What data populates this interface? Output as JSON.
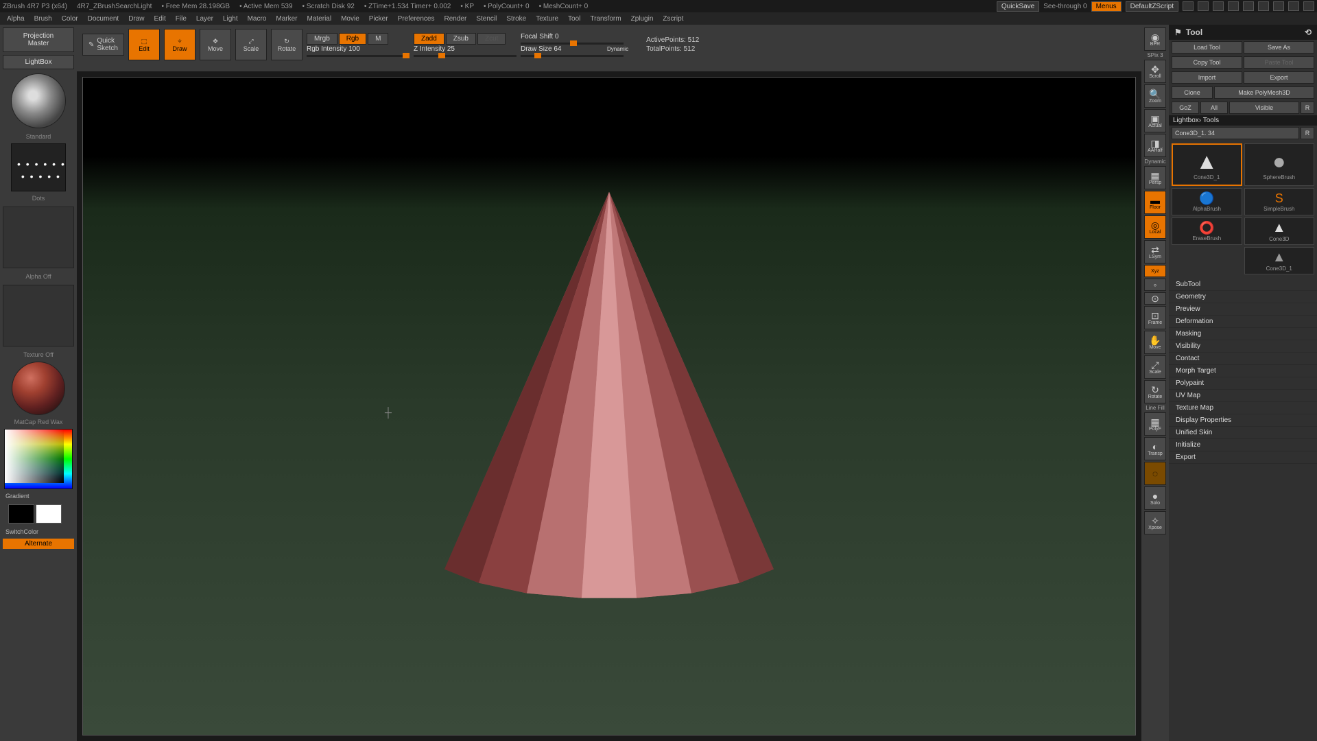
{
  "title": {
    "app": "ZBrush 4R7 P3 (x64)",
    "doc": "4R7_ZBrushSearchLight",
    "freemem": "• Free Mem 28.198GB",
    "activemem": "• Active Mem 539",
    "scratch": "• Scratch Disk 92",
    "ztime": "• ZTime+1.534 Timer+ 0.002",
    "kp": "• KP",
    "polycount": "• PolyCount+ 0",
    "meshcount": "• MeshCount+ 0"
  },
  "titleRight": {
    "quicksave": "QuickSave",
    "seethrough": "See-through   0",
    "menus": "Menus",
    "script": "DefaultZScript"
  },
  "menus": [
    "Alpha",
    "Brush",
    "Color",
    "Document",
    "Draw",
    "Edit",
    "File",
    "Layer",
    "Light",
    "Macro",
    "Marker",
    "Material",
    "Movie",
    "Picker",
    "Preferences",
    "Render",
    "Stencil",
    "Stroke",
    "Texture",
    "Tool",
    "Transform",
    "Zplugin",
    "Zscript"
  ],
  "leftPanel": {
    "projection": "Projection\nMaster",
    "lightbox": "LightBox",
    "standard": "Standard",
    "dots": "Dots",
    "alphaOff": "Alpha Off",
    "textureOff": "Texture Off",
    "matcap": "MatCap Red Wax",
    "gradient": "Gradient",
    "switchcolor": "SwitchColor",
    "alternate": "Alternate"
  },
  "toolbar": {
    "quicksketch": "Quick\nSketch",
    "edit": "Edit",
    "draw": "Draw",
    "move": "Move",
    "scale": "Scale",
    "rotate": "Rotate",
    "mrgb": "Mrgb",
    "rgb": "Rgb",
    "m": "M",
    "rgbIntensity": "Rgb Intensity 100",
    "zadd": "Zadd",
    "zsub": "Zsub",
    "zcut": "Zcut",
    "zIntensity": "Z Intensity 25",
    "focalShift": "Focal Shift 0",
    "drawSize": "Draw Size 64",
    "dynamic": "Dynamic",
    "activePoints": "ActivePoints: 512",
    "totalPoints": "TotalPoints: 512"
  },
  "sideTools": {
    "bpr": "BPR",
    "spix": "SPix 3",
    "scroll": "Scroll",
    "zoom": "Zoom",
    "actual": "Actual",
    "aahalf": "AAHalf",
    "dynamicp": "Dynamic",
    "persp": "Persp",
    "floor": "Floor",
    "local": "Local",
    "lsym": "LSym",
    "xyz": "Xyz",
    "frame": "Frame",
    "movev": "Move",
    "scalev": "Scale",
    "rotatev": "Rotate",
    "linefill": "Line Fill",
    "polyf": "PolyF",
    "transp": "Transp",
    "solo": "Solo",
    "xpose": "Xpose"
  },
  "rightPanel": {
    "header": "Tool",
    "loadTool": "Load Tool",
    "saveAs": "Save As",
    "copyTool": "Copy Tool",
    "pasteTool": "Paste Tool",
    "import": "Import",
    "export": "Export",
    "clone": "Clone",
    "makePoly": "Make PolyMesh3D",
    "goz": "GoZ",
    "all": "All",
    "visible": "Visible",
    "r": "R",
    "lightboxTools": "Lightbox› Tools",
    "toolName": "Cone3D_1. 34",
    "thumbs": [
      "Cone3D_1",
      "SphereBrush",
      "AlphaBrush",
      "SimpleBrush",
      "EraseBrush",
      "Cone3D",
      "Cone3D_1"
    ],
    "accordion": [
      "SubTool",
      "Geometry",
      "Preview",
      "Deformation",
      "Masking",
      "Visibility",
      "Contact",
      "Morph Target",
      "Polypaint",
      "UV Map",
      "Texture Map",
      "Display Properties",
      "Unified Skin",
      "Initialize",
      "Export"
    ]
  }
}
